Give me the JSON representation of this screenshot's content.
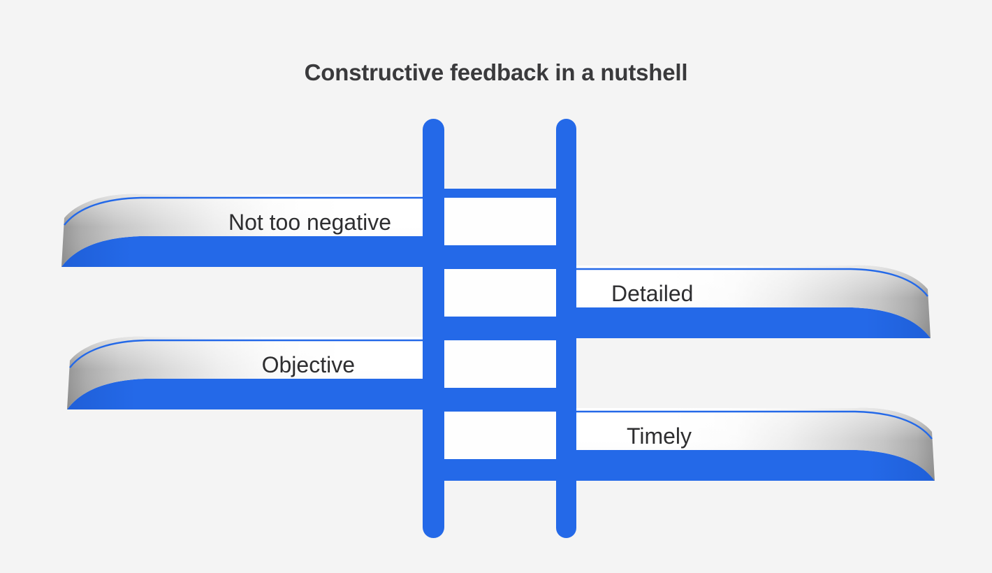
{
  "page": {
    "title": "Constructive feedback in a nutshell",
    "background_color": "#f4f4f4",
    "title_color": "#3a3a3c"
  },
  "theme": {
    "accent_blue": "#2469e8",
    "ribbon_light": "#ffffff",
    "ribbon_shadow": "#9a9a9a",
    "text_color": "#2e2e30",
    "rung_fill": "#fefefe"
  },
  "diagram": {
    "type": "ladder-infographic",
    "name": "constructive-feedback-ladder",
    "ladder": {
      "name": "ladder-icon",
      "rails": 2,
      "rungs": 5
    },
    "banners": [
      {
        "id": "not-too-negative",
        "label": "Not too negative",
        "side": "left",
        "row": 1
      },
      {
        "id": "detailed",
        "label": "Detailed",
        "side": "right",
        "row": 2
      },
      {
        "id": "objective",
        "label": "Objective",
        "side": "left",
        "row": 3
      },
      {
        "id": "timely",
        "label": "Timely",
        "side": "right",
        "row": 4
      }
    ]
  }
}
